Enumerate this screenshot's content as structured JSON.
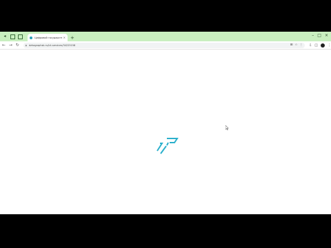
{
  "browser": {
    "tab_title": "Цифровой государственный",
    "tab_close": "×",
    "new_tab": "+",
    "url": "dzhagraphsk.ru/ict-services/34225158",
    "window_controls": [
      "–",
      "□",
      "×"
    ],
    "nav": {
      "back": "←",
      "forward": "→",
      "reload": "↻"
    },
    "lock_icon": "lock-icon",
    "omni_actions": [
      "⊞",
      "☆",
      "⋮"
    ],
    "toolbar_icons": [
      "⇩",
      "◫",
      "⋮"
    ]
  },
  "page": {
    "logo_color": "#2bb0cc",
    "background": "#ffffff"
  }
}
